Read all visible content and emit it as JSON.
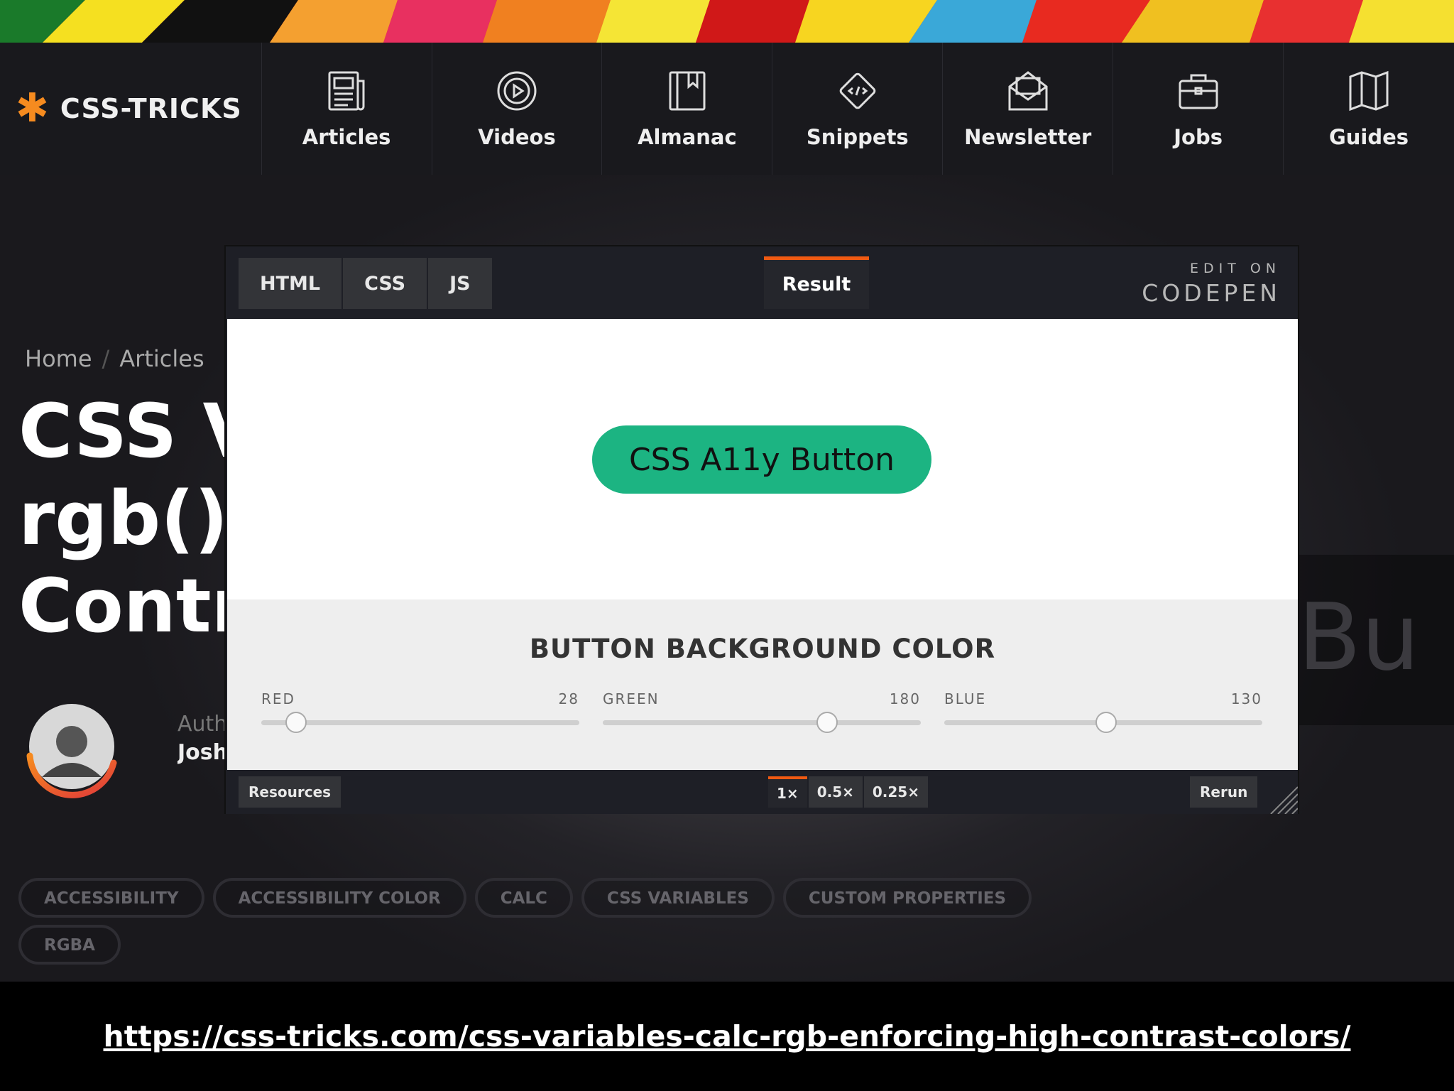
{
  "site": {
    "logo_text": "CSS-TRICKS",
    "logo_icon": "asterisk-icon",
    "accent_color": "#f68b1f"
  },
  "nav": {
    "items": [
      {
        "label": "Articles",
        "icon": "newspaper-icon"
      },
      {
        "label": "Videos",
        "icon": "play-circle-icon"
      },
      {
        "label": "Almanac",
        "icon": "book-icon"
      },
      {
        "label": "Snippets",
        "icon": "code-diamond-icon"
      },
      {
        "label": "Newsletter",
        "icon": "envelope-icon"
      },
      {
        "label": "Jobs",
        "icon": "briefcase-icon"
      },
      {
        "label": "Guides",
        "icon": "map-icon"
      }
    ]
  },
  "article": {
    "breadcrumb": [
      "Home",
      "Articles"
    ],
    "title_lines": [
      "CSS V",
      "rgb()",
      "Contr"
    ],
    "author_label": "Auth",
    "author_name": "Josh",
    "faded_text": "Bu",
    "tags": [
      "ACCESSIBILITY",
      "ACCESSIBILITY COLOR",
      "CALC",
      "CSS VARIABLES",
      "CUSTOM PROPERTIES",
      "RGBA"
    ]
  },
  "embed": {
    "tabs": [
      "HTML",
      "CSS",
      "JS"
    ],
    "active_tab": "Result",
    "edit_on": "EDIT ON",
    "brand": "CODEPEN",
    "button_label": "CSS A11y Button",
    "button_color": "#1cb482",
    "controls_title": "BUTTON BACKGROUND COLOR",
    "sliders": [
      {
        "label": "RED",
        "value": "28",
        "fraction": 0.11
      },
      {
        "label": "GREEN",
        "value": "180",
        "fraction": 0.706
      },
      {
        "label": "BLUE",
        "value": "130",
        "fraction": 0.51
      }
    ],
    "resources_label": "Resources",
    "zoom_options": [
      "1×",
      "0.5×",
      "0.25×"
    ],
    "rerun_label": "Rerun",
    "tab_accent": "#f05a12"
  },
  "footer": {
    "url": "https://css-tricks.com/css-variables-calc-rgb-enforcing-high-contrast-colors/"
  }
}
